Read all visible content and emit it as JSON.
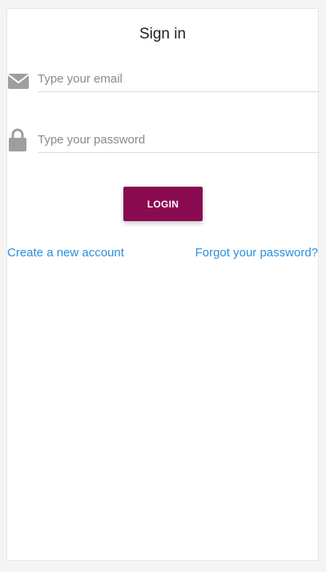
{
  "form": {
    "title": "Sign in",
    "email": {
      "icon": "envelope-icon",
      "placeholder": "Type your email",
      "value": ""
    },
    "password": {
      "icon": "lock-icon",
      "placeholder": "Type your password",
      "value": ""
    },
    "login_label": "LOGIN",
    "create_account_label": "Create a new account",
    "forgot_password_label": "Forgot your password?"
  },
  "colors": {
    "accent": "#8a0a4f",
    "link": "#2c8fdc",
    "icon": "#9e9e9e",
    "background": "#f4f4f4",
    "card": "#ffffff"
  }
}
